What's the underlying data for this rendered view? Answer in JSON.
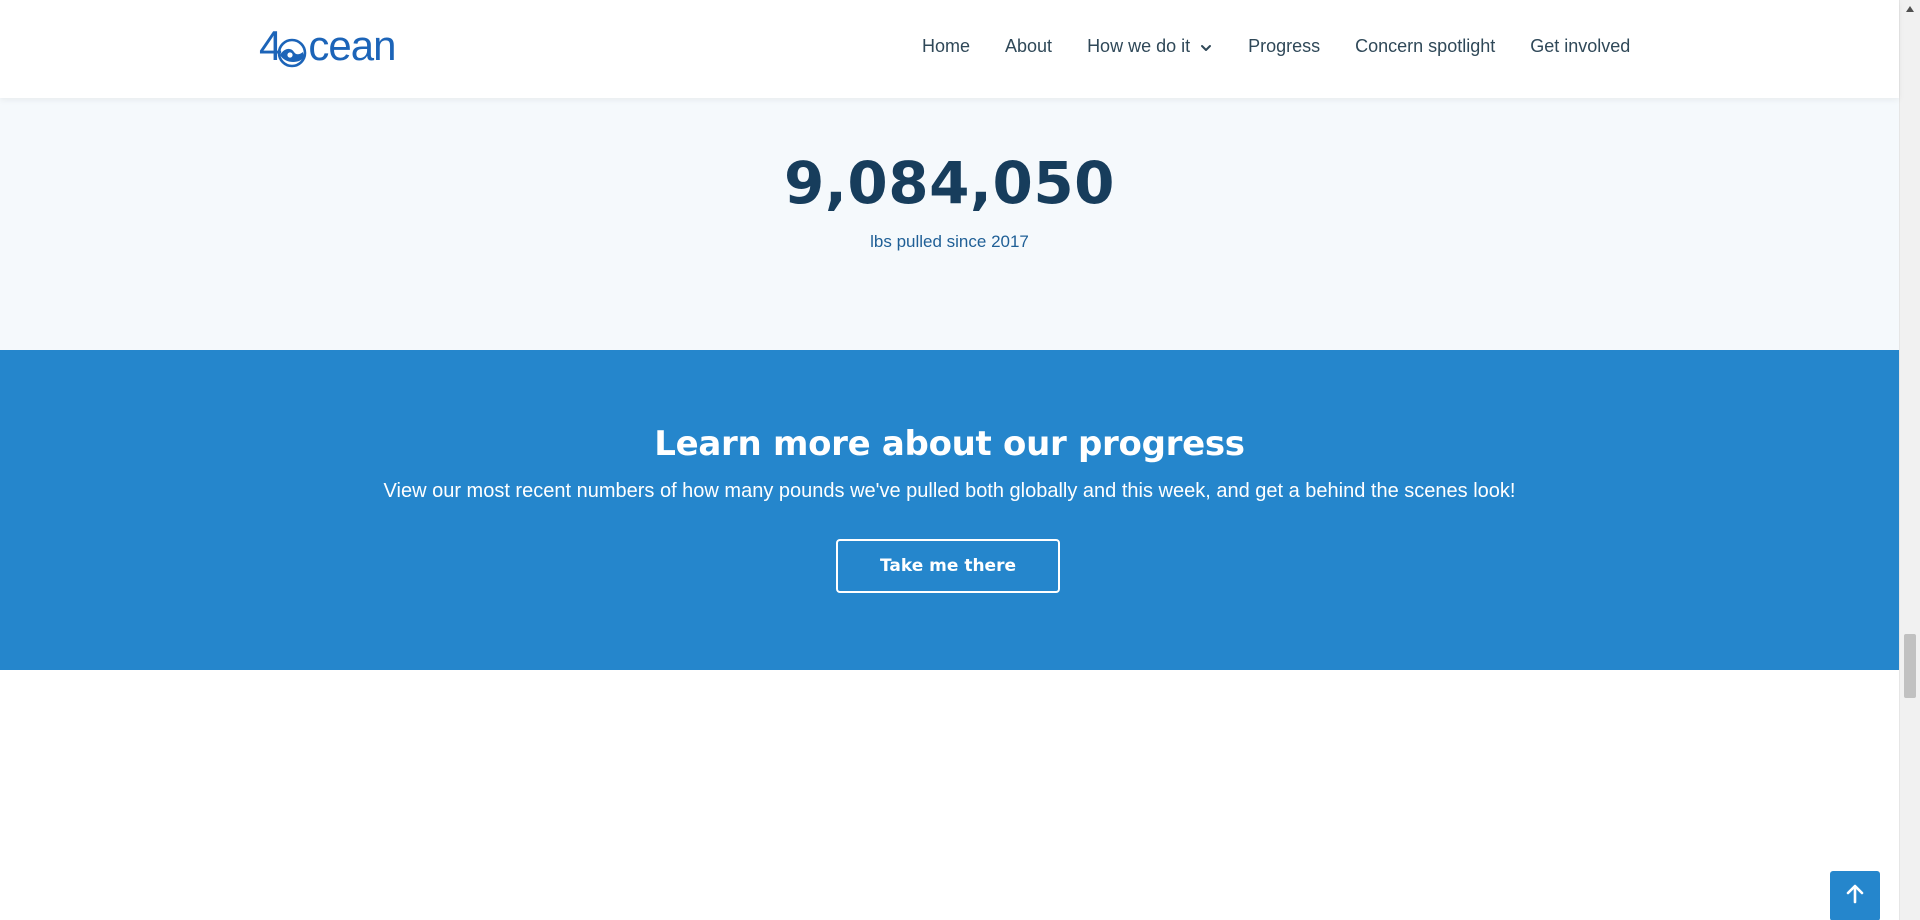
{
  "header": {
    "logo": {
      "prefix": "4",
      "suffix": "cean",
      "color": "#1c64b8"
    },
    "nav": [
      {
        "label": "Home"
      },
      {
        "label": "About"
      },
      {
        "label": "How we do it",
        "has_dropdown": true,
        "dropdown_icon": "chevron-down-icon"
      },
      {
        "label": "Progress"
      },
      {
        "label": "Concern spotlight"
      },
      {
        "label": "Get involved"
      }
    ]
  },
  "stats": {
    "number": "9,084,050",
    "caption": "lbs pulled since 2017",
    "number_color": "#173d5c",
    "caption_color": "#1f5f96",
    "background": "#f5f9fc"
  },
  "cta": {
    "title": "Learn more about our progress",
    "text": "View our most recent numbers of how many pounds we've pulled both globally and this week, and get a behind the scenes look!",
    "button_label": "Take me there",
    "background": "#2586cc"
  },
  "scroll_top": {
    "icon": "arrow-up-icon",
    "color": "#2586cc"
  }
}
